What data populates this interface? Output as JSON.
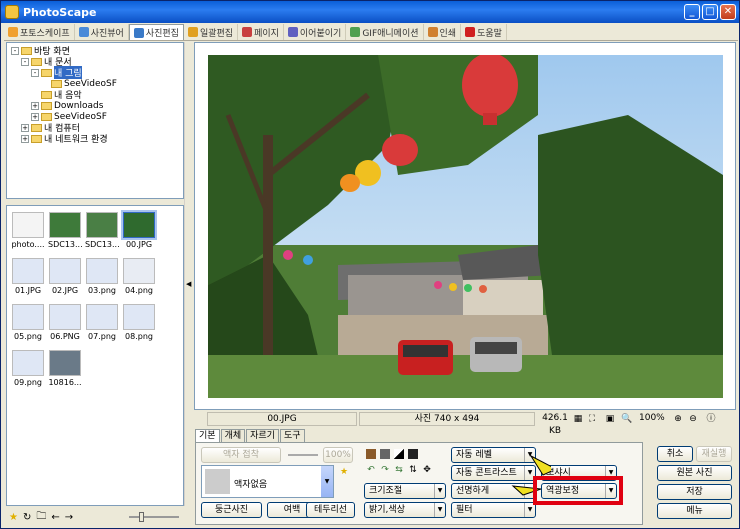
{
  "window": {
    "title": "PhotoScape"
  },
  "tabs": [
    {
      "label": "포토스케이프",
      "icon": "photoscape-icon",
      "color": "#f0a030"
    },
    {
      "label": "사진뷰어",
      "icon": "viewer-icon",
      "color": "#4a8ad8"
    },
    {
      "label": "사진편집",
      "icon": "editor-icon",
      "color": "#3a7ac8"
    },
    {
      "label": "일괄편집",
      "icon": "batch-icon",
      "color": "#e0a020"
    },
    {
      "label": "페이지",
      "icon": "page-icon",
      "color": "#c84040"
    },
    {
      "label": "이어붙이기",
      "icon": "combine-icon",
      "color": "#6060c0"
    },
    {
      "label": "GIF애니메이션",
      "icon": "gif-icon",
      "color": "#50a050"
    },
    {
      "label": "인쇄",
      "icon": "print-icon",
      "color": "#d08030"
    },
    {
      "label": "도움말",
      "icon": "help-icon",
      "color": "#d02020"
    }
  ],
  "active_tab": 2,
  "tree": [
    {
      "label": "바탕 화면",
      "pm": "-"
    },
    {
      "label": "내 문서",
      "pm": "-"
    },
    {
      "label": "내 그림",
      "pm": "-"
    },
    {
      "label": "SeeVideoSF",
      "pm": ""
    },
    {
      "label": "내 음악",
      "pm": ""
    },
    {
      "label": "Downloads",
      "pm": "+"
    },
    {
      "label": "SeeVideoSF",
      "pm": "+"
    },
    {
      "label": "내 컴퓨터",
      "pm": "+"
    },
    {
      "label": "내 네트워크 환경",
      "pm": "+"
    }
  ],
  "thumbnails": [
    {
      "name": "photo....",
      "color": "#f4f4f4"
    },
    {
      "name": "SDC13...",
      "color": "#3e7a3a"
    },
    {
      "name": "SDC13...",
      "color": "#4a7f45"
    },
    {
      "name": "00.JPG",
      "color": "#2f6a2e"
    },
    {
      "name": "01.JPG",
      "color": "#dfe7f5"
    },
    {
      "name": "02.JPG",
      "color": "#dfe7f5"
    },
    {
      "name": "03.png",
      "color": "#dfe7f5"
    },
    {
      "name": "04.png",
      "color": "#e8ecf3"
    },
    {
      "name": "05.png",
      "color": "#dfe7f5"
    },
    {
      "name": "06.PNG",
      "color": "#dfe7f5"
    },
    {
      "name": "07.png",
      "color": "#dfe7f5"
    },
    {
      "name": "08.png",
      "color": "#dfe7f5"
    },
    {
      "name": "09.png",
      "color": "#dfe7f5"
    },
    {
      "name": "10816...",
      "color": "#6a7a88"
    }
  ],
  "status": {
    "filename": "00.JPG",
    "dimensions": "사진 740 x 494",
    "filesize": "426.1 KB",
    "zoom": "100%"
  },
  "panel_tabs": [
    "기본",
    "개체",
    "자르기",
    "도구"
  ],
  "panel": {
    "frame_join": "액자 접착",
    "frame_zoom": "100%",
    "frame_name": "액자없음",
    "round_photo": "둥근사진",
    "margin": "여백",
    "decoration": "테두리선",
    "resize": "크기조절",
    "brightness": "밝기,색상",
    "auto_level": "자동 레벨",
    "auto_contrast": "자동 콘트라스트",
    "sharpen": "선명하게",
    "filter": "필터",
    "bloom": "뽀샤시",
    "backlight": "역광보정"
  },
  "right_buttons": {
    "undo": "취소",
    "redo": "재실행",
    "original": "원본 사진",
    "save": "저장",
    "menu": "메뉴"
  },
  "colors": {
    "highlight": "#e00010",
    "arrow": "#f0e020"
  }
}
